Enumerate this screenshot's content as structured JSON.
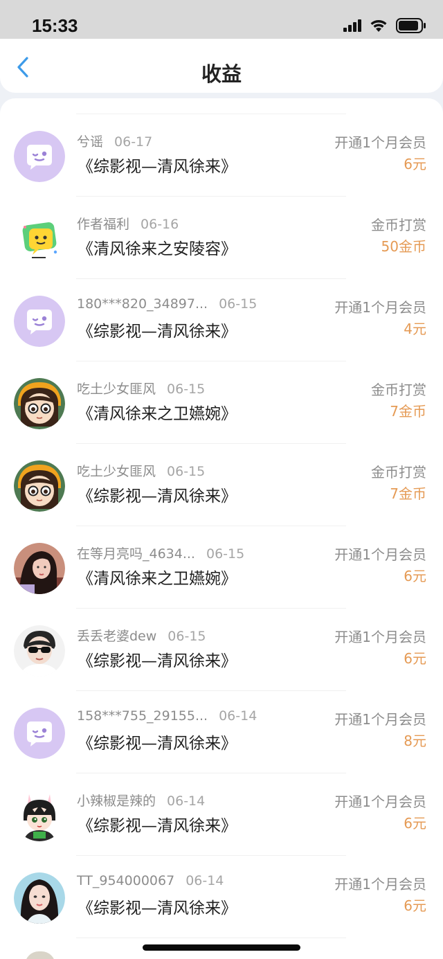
{
  "status_bar": {
    "time": "15:33"
  },
  "header": {
    "title": "收益"
  },
  "items": [
    {
      "name": "兮谣",
      "date": "06-17",
      "book": "《综影视—清风徐来》",
      "type": "开通1个月会员",
      "amount": "6元",
      "avatar": "default-chat-avatar"
    },
    {
      "name": "作者福利",
      "date": "06-16",
      "book": "《清风徐来之安陵容》",
      "type": "金币打赏",
      "amount": "50金币",
      "avatar": "bonus-chat-avatar"
    },
    {
      "name": "180***820_34897...",
      "date": "06-15",
      "book": "《综影视—清风徐来》",
      "type": "开通1个月会员",
      "amount": "4元",
      "avatar": "default-chat-avatar"
    },
    {
      "name": "吃土少女匪风",
      "date": "06-15",
      "book": "《清风徐来之卫嬿婉》",
      "type": "金币打赏",
      "amount": "7金币",
      "avatar": "cartoon-girl-avatar"
    },
    {
      "name": "吃土少女匪风",
      "date": "06-15",
      "book": "《综影视—清风徐来》",
      "type": "金币打赏",
      "amount": "7金币",
      "avatar": "cartoon-girl-avatar"
    },
    {
      "name": "在等月亮吗_4634...",
      "date": "06-15",
      "book": "《清风徐来之卫嬿婉》",
      "type": "开通1个月会员",
      "amount": "6元",
      "avatar": "photo-girl-avatar"
    },
    {
      "name": "丢丢老婆dew",
      "date": "06-15",
      "book": "《综影视—清风徐来》",
      "type": "开通1个月会员",
      "amount": "6元",
      "avatar": "sunglasses-avatar"
    },
    {
      "name": "158***755_29155...",
      "date": "06-14",
      "book": "《综影视—清风徐来》",
      "type": "开通1个月会员",
      "amount": "8元",
      "avatar": "default-chat-avatar"
    },
    {
      "name": "小辣椒是辣的",
      "date": "06-14",
      "book": "《综影视—清风徐来》",
      "type": "开通1个月会员",
      "amount": "6元",
      "avatar": "cartoon-boy-avatar"
    },
    {
      "name": "TT_954000067",
      "date": "06-14",
      "book": "《综影视—清风徐来》",
      "type": "开通1个月会员",
      "amount": "6元",
      "avatar": "photo-woman-avatar"
    }
  ],
  "colors": {
    "accent": "#3d9be9",
    "amount": "#e59a54",
    "default_avatar_bg": "#d7c7f3"
  }
}
